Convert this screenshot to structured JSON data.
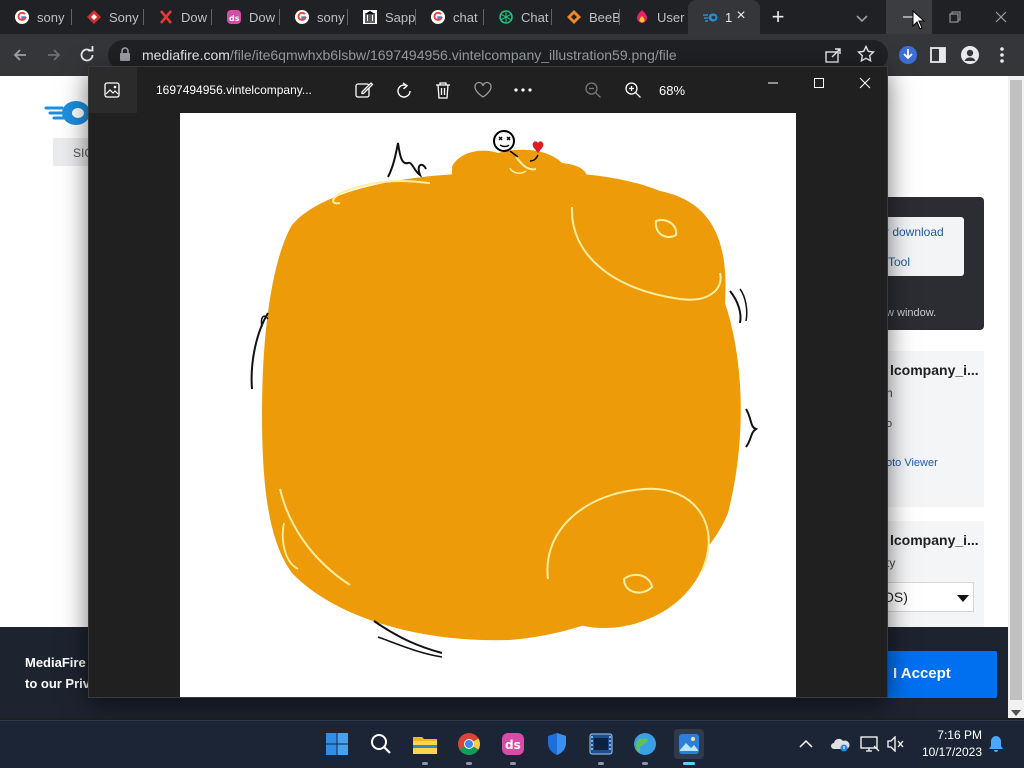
{
  "browser": {
    "tabs": [
      {
        "label": "sony",
        "icon": "google-icon"
      },
      {
        "label": "Sony",
        "icon": "sony-bookmark-icon"
      },
      {
        "label": "Dow",
        "icon": "x-icon"
      },
      {
        "label": "Dow",
        "icon": "dl-site-icon"
      },
      {
        "label": "sony",
        "icon": "google-icon"
      },
      {
        "label": "Sapp",
        "icon": "museum-icon"
      },
      {
        "label": "chat",
        "icon": "google-icon"
      },
      {
        "label": "Chat",
        "icon": "chatgpt-icon"
      },
      {
        "label": "BeeB",
        "icon": "beebom-icon"
      },
      {
        "label": "User",
        "icon": "user-site-icon"
      },
      {
        "label": "1",
        "icon": "mediafire-icon",
        "active": true
      }
    ],
    "url_host": "mediafire.com",
    "url_path": "/file/ite6qmwhxb6lsbw/1697494956.vintelcompany_illustration59.png/file"
  },
  "page": {
    "signin_label": "SIG",
    "download_link": "r download",
    "tool_link": "Tool",
    "new_window_note": "w window.",
    "card1": {
      "title": "lcompany_i...",
      "sub1": "h",
      "sub2": "o",
      "link": "oto Viewer"
    },
    "card2": {
      "title": "lcompany_i...",
      "sub1": "ty",
      "select_value": "OS)"
    },
    "cookie_line1": "MediaFire u",
    "cookie_line2": "to our Priva",
    "accept_label": "I Accept"
  },
  "viewer": {
    "title": "1697494956.vintelcompany...",
    "zoom": "68%"
  },
  "taskbar": {
    "apps": [
      "start-icon",
      "search-icon",
      "file-explorer-icon",
      "chrome-icon",
      "dl-app-icon",
      "security-icon",
      "video-editor-icon",
      "weather-app-icon",
      "photos-icon"
    ],
    "time": "7:16 PM",
    "date": "10/17/2023"
  },
  "colors": {
    "accent": "#0070f0",
    "illustration_fill": "#ee9b0a",
    "illustration_highlight": "#fdeea0"
  }
}
